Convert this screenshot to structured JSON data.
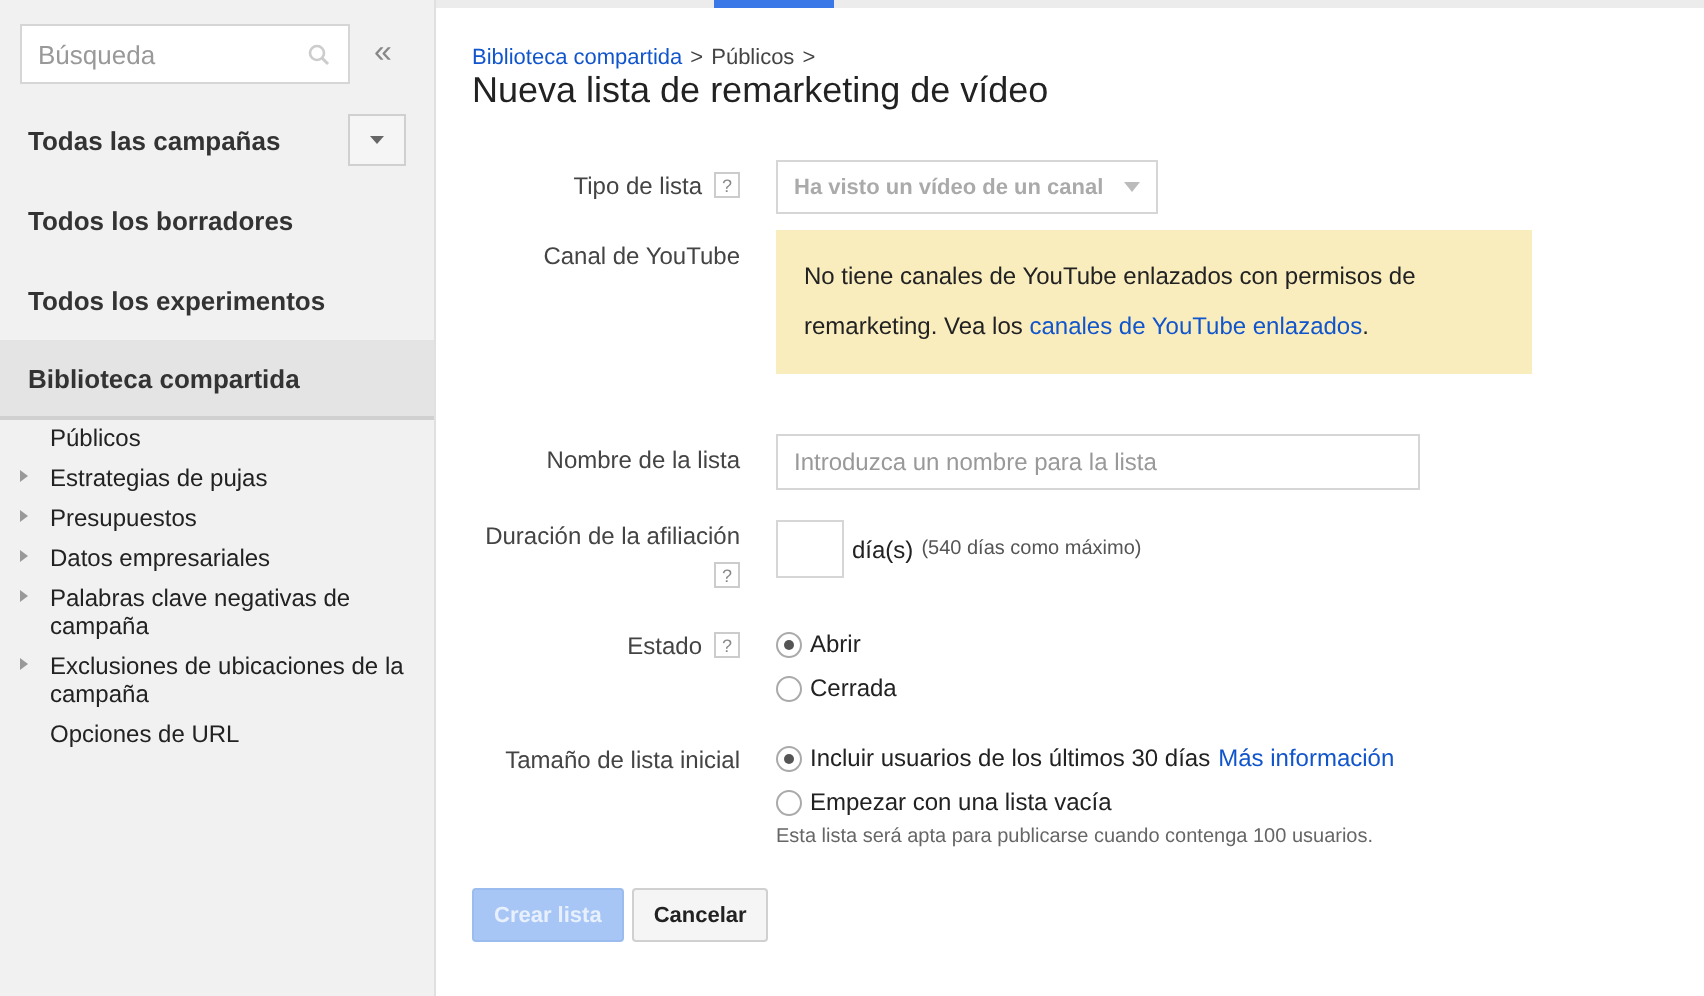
{
  "sidebar": {
    "search": {
      "placeholder": "Búsqueda"
    },
    "collapse": "«",
    "nav": [
      {
        "label": "Todas las campañas",
        "selected": false,
        "dropdown": true
      },
      {
        "label": "Todos los borradores",
        "selected": false,
        "dropdown": false
      },
      {
        "label": "Todos los experimentos",
        "selected": false,
        "dropdown": false
      },
      {
        "label": "Biblioteca compartida",
        "selected": true,
        "dropdown": false
      }
    ],
    "items": [
      {
        "label": "Públicos",
        "expandable": false
      },
      {
        "label": "Estrategias de pujas",
        "expandable": true
      },
      {
        "label": "Presupuestos",
        "expandable": true
      },
      {
        "label": "Datos empresariales",
        "expandable": true
      },
      {
        "label": "Palabras clave negativas de campaña",
        "expandable": true
      },
      {
        "label": "Exclusiones de ubicaciones de la campaña",
        "expandable": true
      },
      {
        "label": "Opciones de URL",
        "expandable": false
      }
    ]
  },
  "breadcrumb": [
    {
      "label": "Biblioteca compartida",
      "link": true
    },
    {
      "label": "Públicos",
      "link": false
    }
  ],
  "breadcrumb_separator": ">",
  "title": "Nueva lista de remarketing de vídeo",
  "form": [
    {
      "kind": "select",
      "label": "Tipo de lista",
      "help": "?",
      "value": "Ha visto un vídeo de un canal",
      "disabled": true
    },
    {
      "kind": "notice",
      "label": "Canal de YouTube",
      "text": "No tiene canales de YouTube enlazados con permisos de remarketing. Vea los ",
      "link": "canales de YouTube enlazados",
      "after": "."
    },
    {
      "kind": "text",
      "label": "Nombre de la lista",
      "placeholder": "Introduzca un nombre para la lista"
    },
    {
      "kind": "days",
      "label": "Duración de la afiliación",
      "help": "?",
      "unit": "día(s)",
      "hint": "(540 días como máximo)"
    },
    {
      "kind": "radio",
      "label": "Estado",
      "help": "?",
      "options": [
        {
          "label": "Abrir",
          "selected": true
        },
        {
          "label": "Cerrada",
          "selected": false
        }
      ]
    },
    {
      "kind": "radio",
      "label": "Tamaño de lista inicial",
      "options": [
        {
          "label": "Incluir usuarios de los últimos 30 días",
          "link": "Más información",
          "selected": true
        },
        {
          "label": "Empezar con una lista vacía",
          "selected": false
        }
      ],
      "note": "Esta lista será apta para publicarse cuando contenga 100 usuarios."
    }
  ],
  "buttons": [
    {
      "label": "Crear lista",
      "primary": true,
      "disabled": true
    },
    {
      "label": "Cancelar",
      "primary": false,
      "disabled": false
    }
  ]
}
